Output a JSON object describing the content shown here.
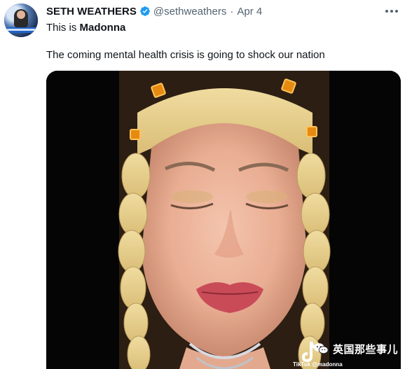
{
  "tweet": {
    "author_name": "SETH WEATHERS",
    "author_handle": "@sethweathers",
    "separator": "·",
    "date": "Apr 4",
    "text_prefix": "This is ",
    "text_bold": "Madonna",
    "text_line2": "The coming mental health crisis is going to shock our nation",
    "verified_icon": "verified-badge-icon",
    "more_icon": "more-options-icon",
    "accent_color": "#1d9bf0"
  },
  "media": {
    "type": "video",
    "tiktok_label": "TikTok",
    "tiktok_username": "@madonna"
  },
  "watermark": {
    "icon": "wechat-icon",
    "text": "英国那些事儿"
  }
}
